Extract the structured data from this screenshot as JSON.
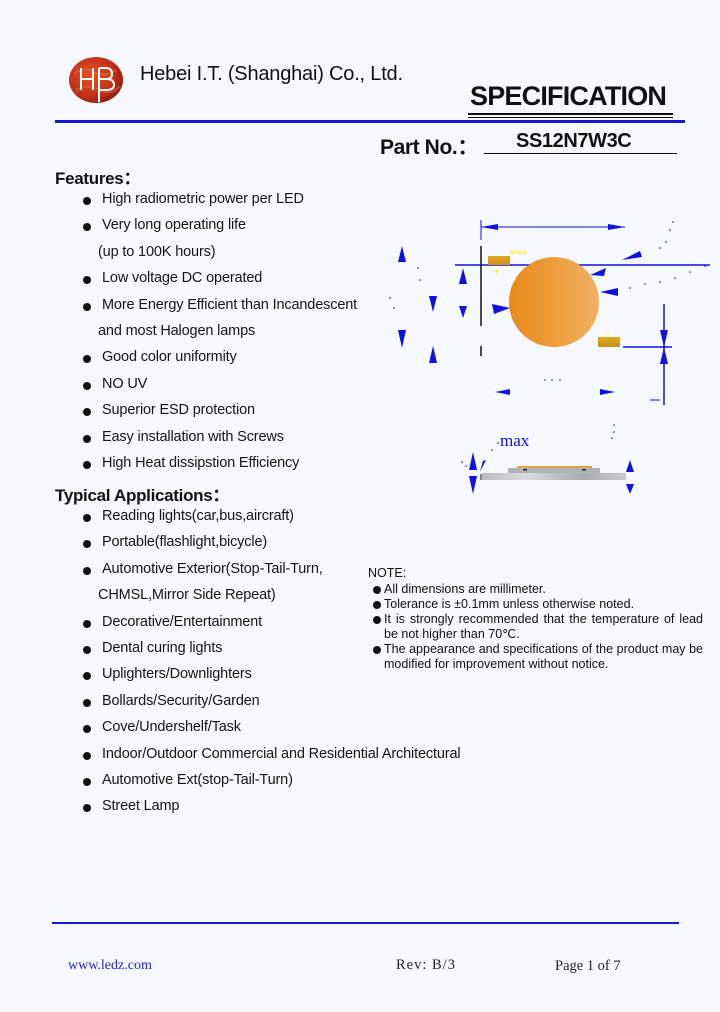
{
  "header": {
    "company_name": "Hebei I.T. (Shanghai) Co., Ltd.",
    "logo_text": "HB",
    "document_type": "SPECIFICATION",
    "part_no_label": "Part No.：",
    "part_no_value": "SS12N7W3C"
  },
  "features": {
    "heading": "Features：",
    "items": [
      {
        "text": "High radiometric power per LED",
        "bullet": true
      },
      {
        "text": "Very long operating life",
        "bullet": true
      },
      {
        "text": "(up to 100K hours)",
        "bullet": false
      },
      {
        "text": "Low voltage DC operated",
        "bullet": true
      },
      {
        "text": "More Energy Efficient than Incandescent",
        "bullet": true
      },
      {
        "text": "and most Halogen lamps",
        "bullet": false
      },
      {
        "text": "Good color uniformity",
        "bullet": true
      },
      {
        "text": "NO UV",
        "bullet": true
      },
      {
        "text": "Superior ESD protection",
        "bullet": true
      },
      {
        "text": "Easy installation with Screws",
        "bullet": true
      },
      {
        "text": "High Heat dissipstion Efficiency",
        "bullet": true
      }
    ]
  },
  "applications": {
    "heading": "Typical Applications：",
    "items": [
      {
        "text": "Reading lights(car,bus,aircraft)",
        "bullet": true
      },
      {
        "text": "Portable(flashlight,bicycle)",
        "bullet": true
      },
      {
        "text": "Automotive Exterior(Stop-Tail-Turn,",
        "bullet": true
      },
      {
        "text": "CHMSL,Mirror Side Repeat)",
        "bullet": false
      },
      {
        "text": "Decorative/Entertainment",
        "bullet": true
      },
      {
        "text": "Dental curing lights",
        "bullet": true
      },
      {
        "text": "Uplighters/Downlighters",
        "bullet": true
      },
      {
        "text": "Bollards/Security/Garden",
        "bullet": true
      },
      {
        "text": "Cove/Undershelf/Task",
        "bullet": true
      },
      {
        "text": "Indoor/Outdoor Commercial and Residential Architectural",
        "bullet": true
      },
      {
        "text": "Automotive Ext(stop-Tail-Turn)",
        "bullet": true
      },
      {
        "text": "Street Lamp",
        "bullet": true
      }
    ]
  },
  "diagram": {
    "pad_label": "sung:L",
    "plus_mark": "+",
    "minus_mark": "−",
    "max_label": "max",
    "colors": {
      "dimension": "#1010e0",
      "led_emitter": "#f0a040",
      "pad": "#d8a020",
      "marker": "#ffee00"
    }
  },
  "note": {
    "heading": "NOTE:",
    "items": [
      "All dimensions are millimeter.",
      "Tolerance is ±0.1mm unless otherwise noted.",
      "It is strongly recommended that the temperature of lead be not higher than 70℃.",
      "The appearance and specifications of the product may be modified for improvement without notice."
    ]
  },
  "footer": {
    "website": "www.ledz.com",
    "revision": "Rev: B/3",
    "page": "Page 1 of 7"
  },
  "colors": {
    "accent_rule": "#1a16d4",
    "logo_red": "#c0301a",
    "background": "#f5f9fd"
  }
}
